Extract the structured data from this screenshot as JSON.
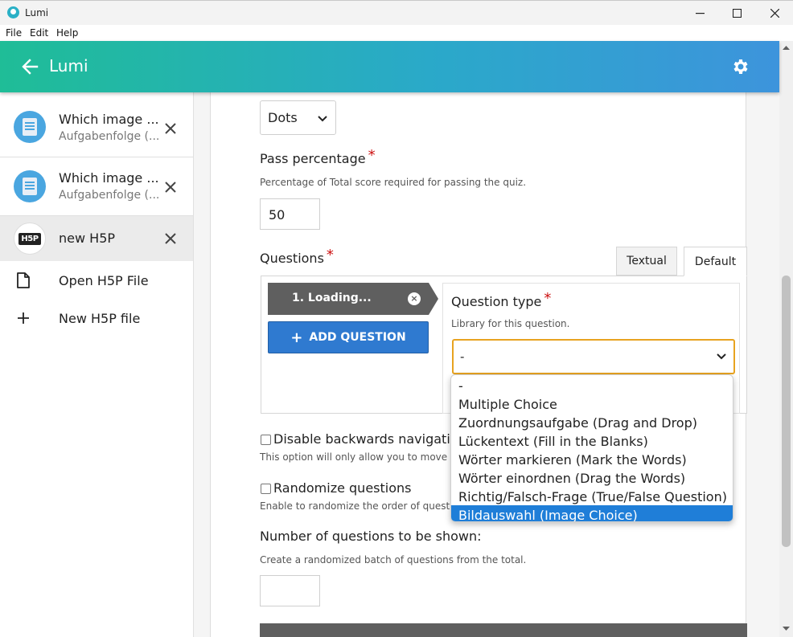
{
  "window": {
    "title": "Lumi",
    "minimize_glyph": "—",
    "maximize_glyph": "☐",
    "close_glyph": "✕"
  },
  "menu": {
    "items": [
      "File",
      "Edit",
      "Help"
    ]
  },
  "appbar": {
    "title": "Lumi",
    "back_icon": "arrow-left-icon",
    "settings_icon": "gear-icon",
    "colors": {
      "start": "#1fbd97",
      "end": "#3d94dc"
    }
  },
  "sidebar": {
    "items": [
      {
        "title": "Which image ...",
        "subtitle": "Aufgabenfolge (...",
        "icon": "document-icon"
      },
      {
        "title": "Which image ...",
        "subtitle": "Aufgabenfolge (...",
        "icon": "document-icon"
      },
      {
        "title": "new H5P",
        "icon": "h5p-logo-icon",
        "logo_text": "H5P"
      }
    ],
    "open_label": "Open H5P File",
    "new_label": "New H5P file"
  },
  "form": {
    "progress_type_value": "Dots",
    "pass_percentage": {
      "label": "Pass percentage",
      "required": "*",
      "description": "Percentage of Total score required for passing the quiz.",
      "value": "50"
    },
    "questions": {
      "label": "Questions",
      "required": "*",
      "tabs": [
        "Textual",
        "Default"
      ],
      "active_tab": "Default",
      "item_label": "1. Loading...",
      "remove_glyph": "×",
      "add_glyph": "+",
      "add_label": "ADD QUESTION"
    },
    "question_type": {
      "label": "Question type",
      "required": "*",
      "description": "Library for this question.",
      "value": "-",
      "options": [
        "-",
        "Multiple Choice",
        "Zuordnungsaufgabe (Drag and Drop)",
        "Lückentext (Fill in the Blanks)",
        "Wörter markieren (Mark the Words)",
        "Wörter einordnen (Drag the Words)",
        "Richtig/Falsch-Frage (True/False Question)",
        "Bildauswahl (Image Choice)"
      ],
      "highlighted_option": "Bildauswahl (Image Choice)"
    },
    "disable_backwards": {
      "label": "Disable backwards navigation",
      "description": "This option will only allow you to move",
      "checked": false
    },
    "randomize": {
      "label": "Randomize questions",
      "description": "Enable to randomize the order of quest",
      "checked": false
    },
    "num_questions": {
      "label": "Number of questions to be shown:",
      "description": "Create a randomized batch of questions from the total.",
      "value": ""
    }
  },
  "colors": {
    "accent_blue": "#2f7ad0",
    "focus_orange": "#e8a320",
    "required_red": "#cc1111",
    "highlight": "#1f7ed8"
  }
}
